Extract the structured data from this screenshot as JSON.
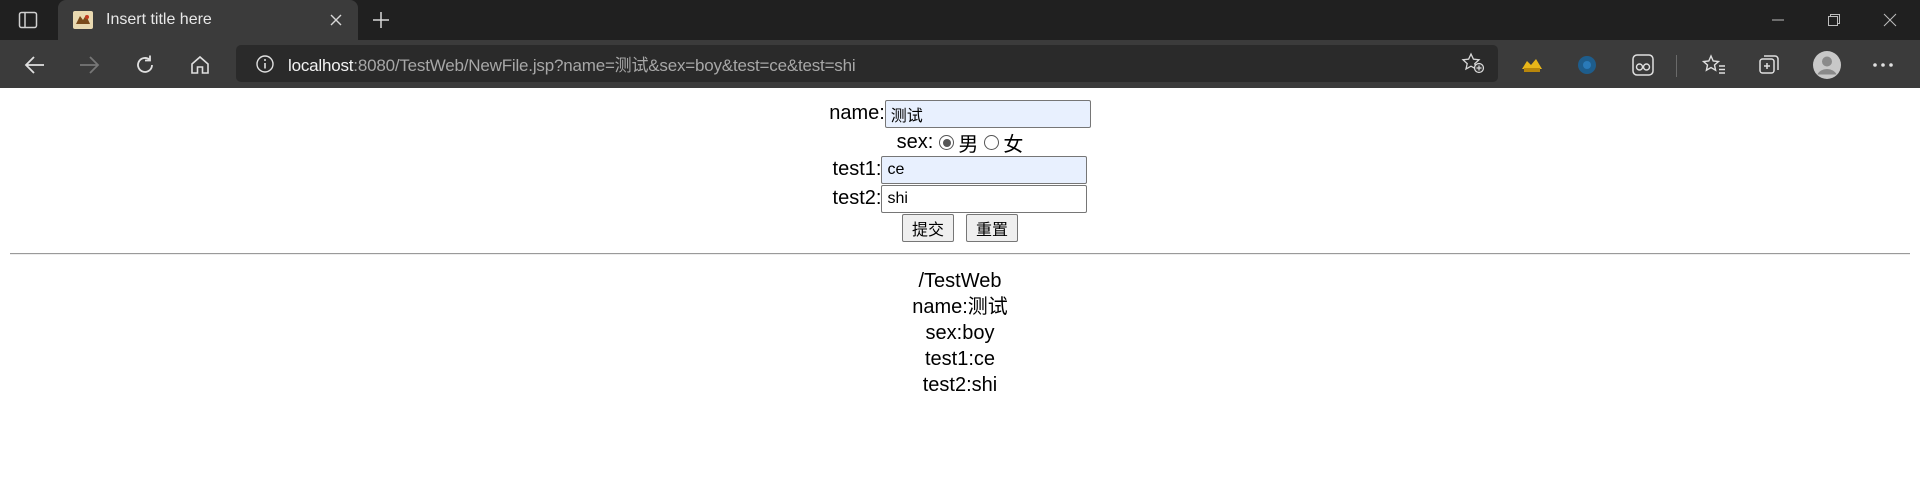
{
  "browser": {
    "tab": {
      "title": "Insert title here"
    },
    "address": {
      "host": "localhost",
      "rest": ":8080/TestWeb/NewFile.jsp?name=测试&sex=boy&test=ce&test=shi"
    }
  },
  "form": {
    "name_label": "name:",
    "name_value": "测试",
    "sex_label": "sex:",
    "sex_male": "男",
    "sex_female": "女",
    "sex_selected": "男",
    "test1_label": "test1:",
    "test1_value": "ce",
    "test2_label": "test2:",
    "test2_value": "shi",
    "submit_label": "提交",
    "reset_label": "重置"
  },
  "output": {
    "context_path": "/TestWeb",
    "name_line": "name:测试",
    "sex_line": "sex:boy",
    "test1_line": "test1:ce",
    "test2_line": "test2:shi"
  },
  "colors": {
    "tabbar_bg": "#202020",
    "toolbar_bg": "#3b3b3b",
    "autofill_bg": "#e8f0fe"
  }
}
